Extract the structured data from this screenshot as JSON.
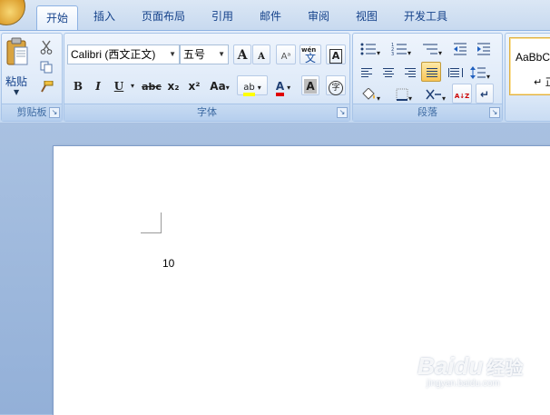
{
  "tabs": [
    {
      "label": "开始",
      "active": true
    },
    {
      "label": "插入"
    },
    {
      "label": "页面布局"
    },
    {
      "label": "引用"
    },
    {
      "label": "邮件"
    },
    {
      "label": "审阅"
    },
    {
      "label": "视图"
    },
    {
      "label": "开发工具"
    }
  ],
  "clipboard": {
    "paste_label": "粘贴",
    "group_label": "剪贴板"
  },
  "font": {
    "font_name": "Calibri (西文正文)",
    "font_size": "五号",
    "grow_label": "A",
    "shrink_label": "A",
    "clear_label": "Aᵃ",
    "phonetic_label": "文",
    "phonetic_top": "wén",
    "border_label": "A",
    "bold_label": "B",
    "italic_label": "I",
    "underline_label": "U",
    "strike_label": "abc",
    "subscript_label": "x₂",
    "superscript_label": "x²",
    "case_label": "Aa",
    "highlight_label": "ab",
    "color_label": "A",
    "shade_label": "A",
    "enclose_label": "字",
    "group_label": "字体",
    "highlight_color": "#ffff00",
    "font_color": "#e00000"
  },
  "paragraph": {
    "sort_label": "A↓Z",
    "marks_label": "↵",
    "group_label": "段落"
  },
  "styles": {
    "preview_label": "AaBbCc",
    "style_name": "↵ 正文"
  },
  "document": {
    "body_text": "10"
  },
  "watermark": {
    "logo": "Bai",
    "logo_suffix": "du",
    "subtitle": "经验",
    "url": "jingyan.baidu.com"
  }
}
